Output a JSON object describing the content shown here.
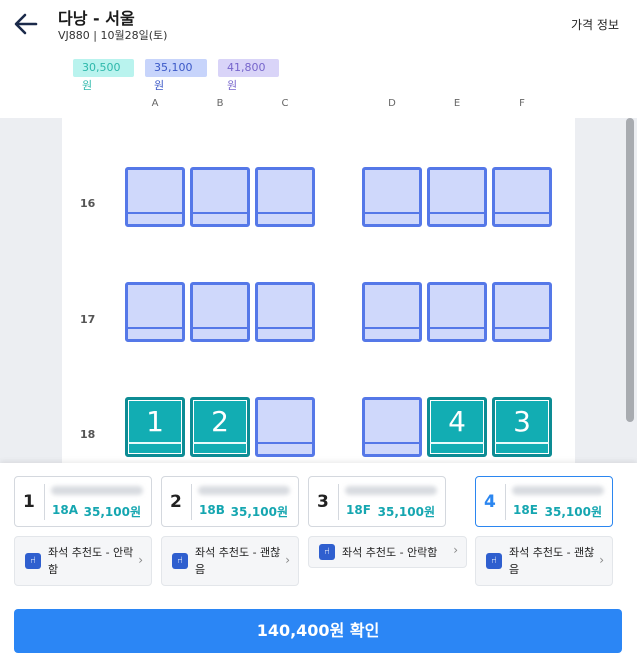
{
  "header": {
    "route": "다낭 - 서울",
    "flight_info": "VJ880 | 10월28일(토)",
    "price_info_label": "가격 정보"
  },
  "fares": [
    "30,500원",
    "35,100원",
    "41,800원"
  ],
  "columns": [
    "A",
    "B",
    "C",
    "D",
    "E",
    "F"
  ],
  "rows": [
    "16",
    "17",
    "18"
  ],
  "selected_seats": {
    "18A": "1",
    "18B": "2",
    "18E": "4",
    "18F": "3"
  },
  "passengers": [
    {
      "index": "1",
      "seat": "18A",
      "price": "35,100원"
    },
    {
      "index": "2",
      "seat": "18B",
      "price": "35,100원"
    },
    {
      "index": "3",
      "seat": "18F",
      "price": "35,100원"
    },
    {
      "index": "4",
      "seat": "18E",
      "price": "35,100원"
    }
  ],
  "recommendations": [
    {
      "text": "좌석 추천도 - 안락함"
    },
    {
      "text": "좌석 추천도 - 괜찮음"
    },
    {
      "text": "좌석 추천도 - 안락함"
    },
    {
      "text": "좌석 추천도 - 괜찮음"
    }
  ],
  "confirm_label": "140,400원 확인",
  "colors": {
    "seat_available": "#cfd8fb",
    "seat_border": "#5578e8",
    "seat_selected": "#12adb3",
    "primary": "#2b86f5"
  }
}
